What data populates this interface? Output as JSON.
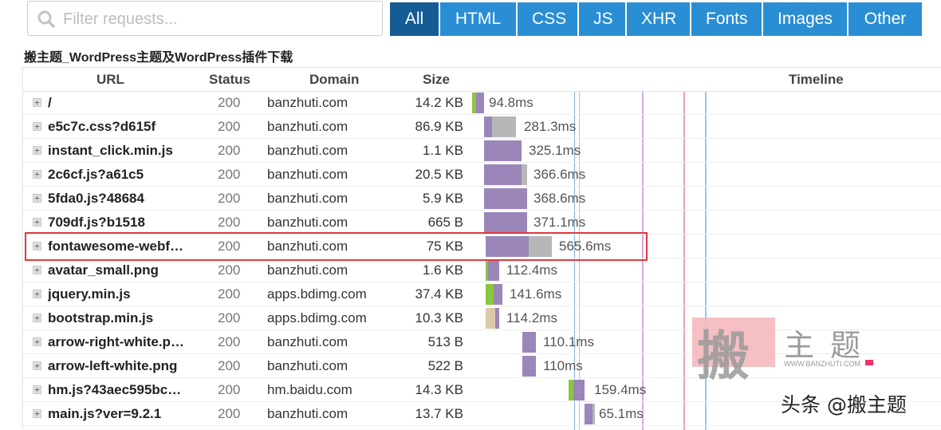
{
  "search": {
    "placeholder": "Filter requests..."
  },
  "filters": [
    "All",
    "HTML",
    "CSS",
    "JS",
    "XHR",
    "Fonts",
    "Images",
    "Other"
  ],
  "active_filter": "All",
  "page_title": "搬主题_WordPress主题及WordPress插件下载",
  "columns": {
    "url": "URL",
    "status": "Status",
    "domain": "Domain",
    "size": "Size",
    "timeline": "Timeline"
  },
  "rows": [
    {
      "url": "/",
      "status": "200",
      "domain": "banzhuti.com",
      "size": "14.2 KB",
      "time": "94.8ms"
    },
    {
      "url": "e5c7c.css?d615f",
      "status": "200",
      "domain": "banzhuti.com",
      "size": "86.9 KB",
      "time": "281.3ms"
    },
    {
      "url": "instant_click.min.js",
      "status": "200",
      "domain": "banzhuti.com",
      "size": "1.1 KB",
      "time": "325.1ms"
    },
    {
      "url": "2c6cf.js?a61c5",
      "status": "200",
      "domain": "banzhuti.com",
      "size": "20.5 KB",
      "time": "366.6ms"
    },
    {
      "url": "5fda0.js?48684",
      "status": "200",
      "domain": "banzhuti.com",
      "size": "5.9 KB",
      "time": "368.6ms"
    },
    {
      "url": "709df.js?b1518",
      "status": "200",
      "domain": "banzhuti.com",
      "size": "665 B",
      "time": "371.1ms"
    },
    {
      "url": "fontawesome-webf…",
      "status": "200",
      "domain": "banzhuti.com",
      "size": "75 KB",
      "time": "565.6ms"
    },
    {
      "url": "avatar_small.png",
      "status": "200",
      "domain": "banzhuti.com",
      "size": "1.6 KB",
      "time": "112.4ms"
    },
    {
      "url": "jquery.min.js",
      "status": "200",
      "domain": "apps.bdimg.com",
      "size": "37.4 KB",
      "time": "141.6ms"
    },
    {
      "url": "bootstrap.min.js",
      "status": "200",
      "domain": "apps.bdimg.com",
      "size": "10.3 KB",
      "time": "114.2ms"
    },
    {
      "url": "arrow-right-white.p…",
      "status": "200",
      "domain": "banzhuti.com",
      "size": "513 B",
      "time": "110.1ms"
    },
    {
      "url": "arrow-left-white.png",
      "status": "200",
      "domain": "banzhuti.com",
      "size": "522 B",
      "time": "110ms"
    },
    {
      "url": "hm.js?43aec595bc…",
      "status": "200",
      "domain": "hm.baidu.com",
      "size": "14.3 KB",
      "time": "159.4ms"
    },
    {
      "url": "main.js?ver=9.2.1",
      "status": "200",
      "domain": "banzhuti.com",
      "size": "13.7 KB",
      "time": "65.1ms"
    }
  ],
  "highlighted_row": "fontawesome-webf…",
  "watermark": {
    "stamp": "搬",
    "name": "主题",
    "url": "WWW.BANZHUTI.COM"
  },
  "attribution": "头条 @搬主题",
  "colors": {
    "tab": "#2a8ed4",
    "tab_active": "#145c93",
    "bar_receive": "#9a86b8",
    "bar_wait": "#b7b7b7",
    "bar_connect": "#8cc63f",
    "highlight": "#e0393e"
  }
}
